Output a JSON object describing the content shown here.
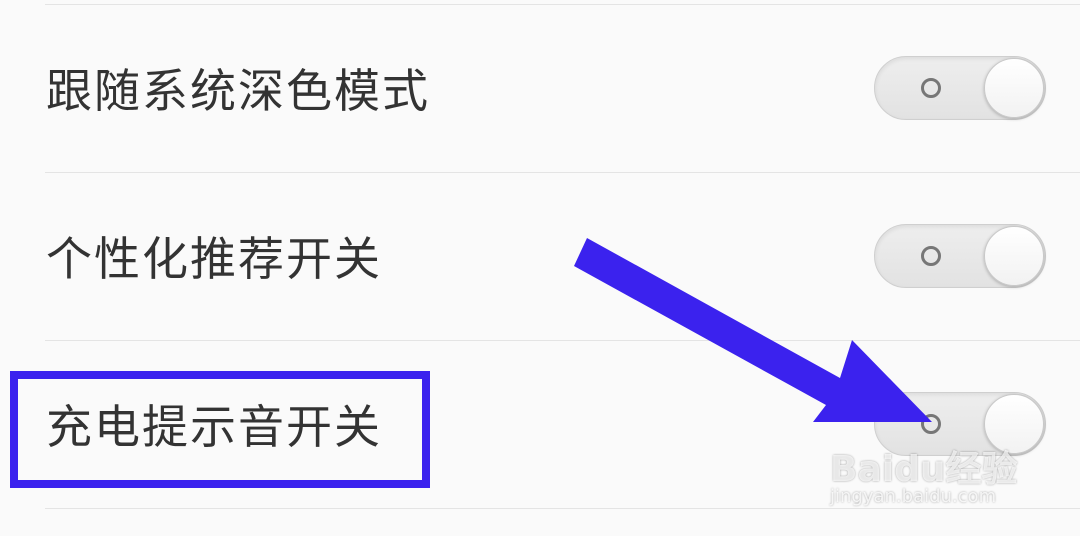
{
  "settings": {
    "items": [
      {
        "label": "跟随系统深色模式",
        "enabled": false
      },
      {
        "label": "个性化推荐开关",
        "enabled": false
      },
      {
        "label": "充电提示音开关",
        "enabled": false
      }
    ]
  },
  "annotation": {
    "highlight_color": "#3b22ee",
    "arrow_color": "#3b22ee"
  },
  "watermark": {
    "logo": "Baidu经验",
    "url": "jingyan.baidu.com"
  }
}
